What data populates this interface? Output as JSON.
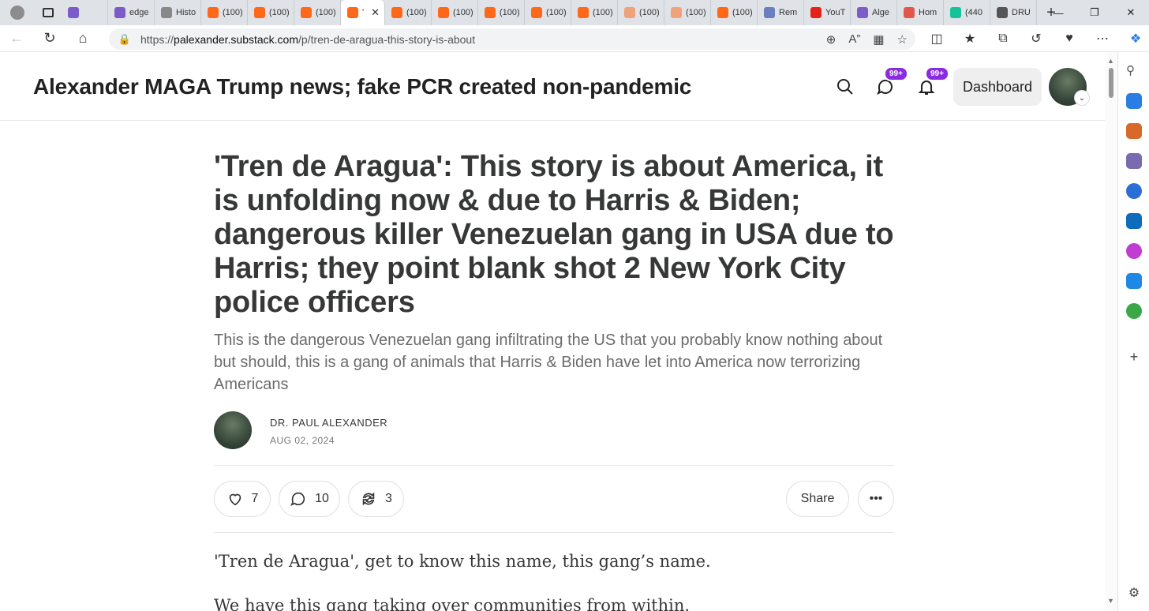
{
  "browser": {
    "tabs": [
      {
        "label": "",
        "icon": "yahoo-icon",
        "color": "#7b5cc9"
      },
      {
        "label": "edge",
        "icon": "yahoo-icon",
        "color": "#7b5cc9"
      },
      {
        "label": "Histo",
        "icon": "history-icon",
        "color": "#888888"
      },
      {
        "label": "(100)",
        "icon": "substack-icon",
        "color": "#ff6719"
      },
      {
        "label": "(100)",
        "icon": "substack-icon",
        "color": "#ff6719"
      },
      {
        "label": "(100)",
        "icon": "substack-icon",
        "color": "#ff6719"
      },
      {
        "label": "'",
        "icon": "substack-icon",
        "color": "#ff6719",
        "active": true
      },
      {
        "label": "(100)",
        "icon": "substack-icon",
        "color": "#ff6719"
      },
      {
        "label": "(100)",
        "icon": "substack-icon",
        "color": "#ff6719"
      },
      {
        "label": "(100)",
        "icon": "substack-icon",
        "color": "#ff6719"
      },
      {
        "label": "(100)",
        "icon": "substack-icon",
        "color": "#ff6719"
      },
      {
        "label": "(100)",
        "icon": "substack-icon",
        "color": "#ff6719"
      },
      {
        "label": "(100)",
        "icon": "substack-icon",
        "color": "#f0a27a"
      },
      {
        "label": "(100)",
        "icon": "substack-icon",
        "color": "#f0a27a"
      },
      {
        "label": "(100)",
        "icon": "substack-icon",
        "color": "#ff6719"
      },
      {
        "label": "Rem",
        "icon": "remote-icon",
        "color": "#6a7fbf"
      },
      {
        "label": "YouT",
        "icon": "youtube-icon",
        "color": "#e62117"
      },
      {
        "label": "Alge",
        "icon": "yahoo-icon",
        "color": "#7b5cc9"
      },
      {
        "label": "Hom",
        "icon": "home-app-icon",
        "color": "#e2574c"
      },
      {
        "label": "(440",
        "icon": "grammarly-icon",
        "color": "#15c39a"
      },
      {
        "label": "DRU",
        "icon": "drudge-icon",
        "color": "#555555"
      }
    ],
    "address": {
      "url_prefix": "https://",
      "url_host": "palexander.substack.com",
      "url_path": "/p/tren-de-aragua-this-story-is-about"
    }
  },
  "header": {
    "site_title": "Alexander MAGA Trump news; fake PCR created non-pandemic",
    "chat_badge": "99+",
    "notif_badge": "99+",
    "dashboard_label": "Dashboard"
  },
  "post": {
    "title": "'Tren de Aragua': This story is about America, it is unfolding now & due to Harris & Biden; dangerous killer Venezuelan gang in USA due to Harris; they point blank shot 2 New York City police officers",
    "subtitle": "This is the dangerous Venezuelan gang infiltrating the US that you probably know nothing about but should, this is a gang of animals that Harris & Biden have let into America now terrorizing Americans",
    "author": "DR. PAUL ALEXANDER",
    "date": "AUG 02, 2024",
    "likes": "7",
    "comments": "10",
    "restacks": "3",
    "share_label": "Share",
    "body": [
      "'Tren de Aragua', get to know this name, this gang’s name.",
      "We have this gang taking over communities from within."
    ]
  },
  "colors": {
    "accent_badge": "#8a2be2",
    "substack_orange": "#ff6719"
  }
}
